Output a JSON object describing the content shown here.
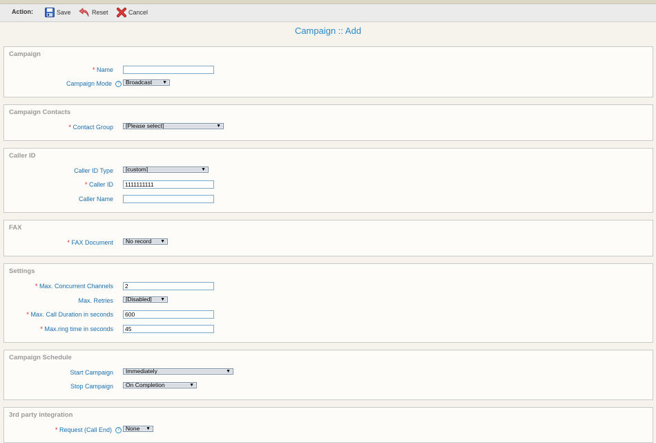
{
  "toolbar": {
    "action_label": "Action:",
    "save_label": "Save",
    "reset_label": "Reset",
    "cancel_label": "Cancel"
  },
  "page_title": "Campaign :: Add",
  "required_mark": "*",
  "help_glyph": "?",
  "arrow_glyph": "▼",
  "sections": {
    "campaign": {
      "title": "Campaign",
      "name_label": "Name",
      "name_value": "",
      "mode_label": "Campaign Mode",
      "mode_value": "Broadcast"
    },
    "contacts": {
      "title": "Campaign Contacts",
      "group_label": "Contact Group",
      "group_value": "[Please select]"
    },
    "callerid": {
      "title": "Caller ID",
      "type_label": "Caller ID Type",
      "type_value": "[custom]",
      "id_label": "Caller ID",
      "id_value": "1111111111",
      "name_label": "Caller Name",
      "name_value": ""
    },
    "fax": {
      "title": "FAX",
      "doc_label": "FAX Document",
      "doc_value": "No record"
    },
    "settings": {
      "title": "Settings",
      "channels_label": "Max. Concurrent Channels",
      "channels_value": "2",
      "retries_label": "Max. Retries",
      "retries_value": "[Disabled]",
      "duration_label": "Max. Call Duration in seconds",
      "duration_value": "600",
      "ring_label": "Max.ring time in seconds",
      "ring_value": "45"
    },
    "schedule": {
      "title": "Campaign Schedule",
      "start_label": "Start Campaign",
      "start_value": "Immediately",
      "stop_label": "Stop Campaign",
      "stop_value": "On Completion"
    },
    "integration": {
      "title": "3rd party integration",
      "request_label": "Request (Call End)",
      "request_value": "None"
    }
  }
}
